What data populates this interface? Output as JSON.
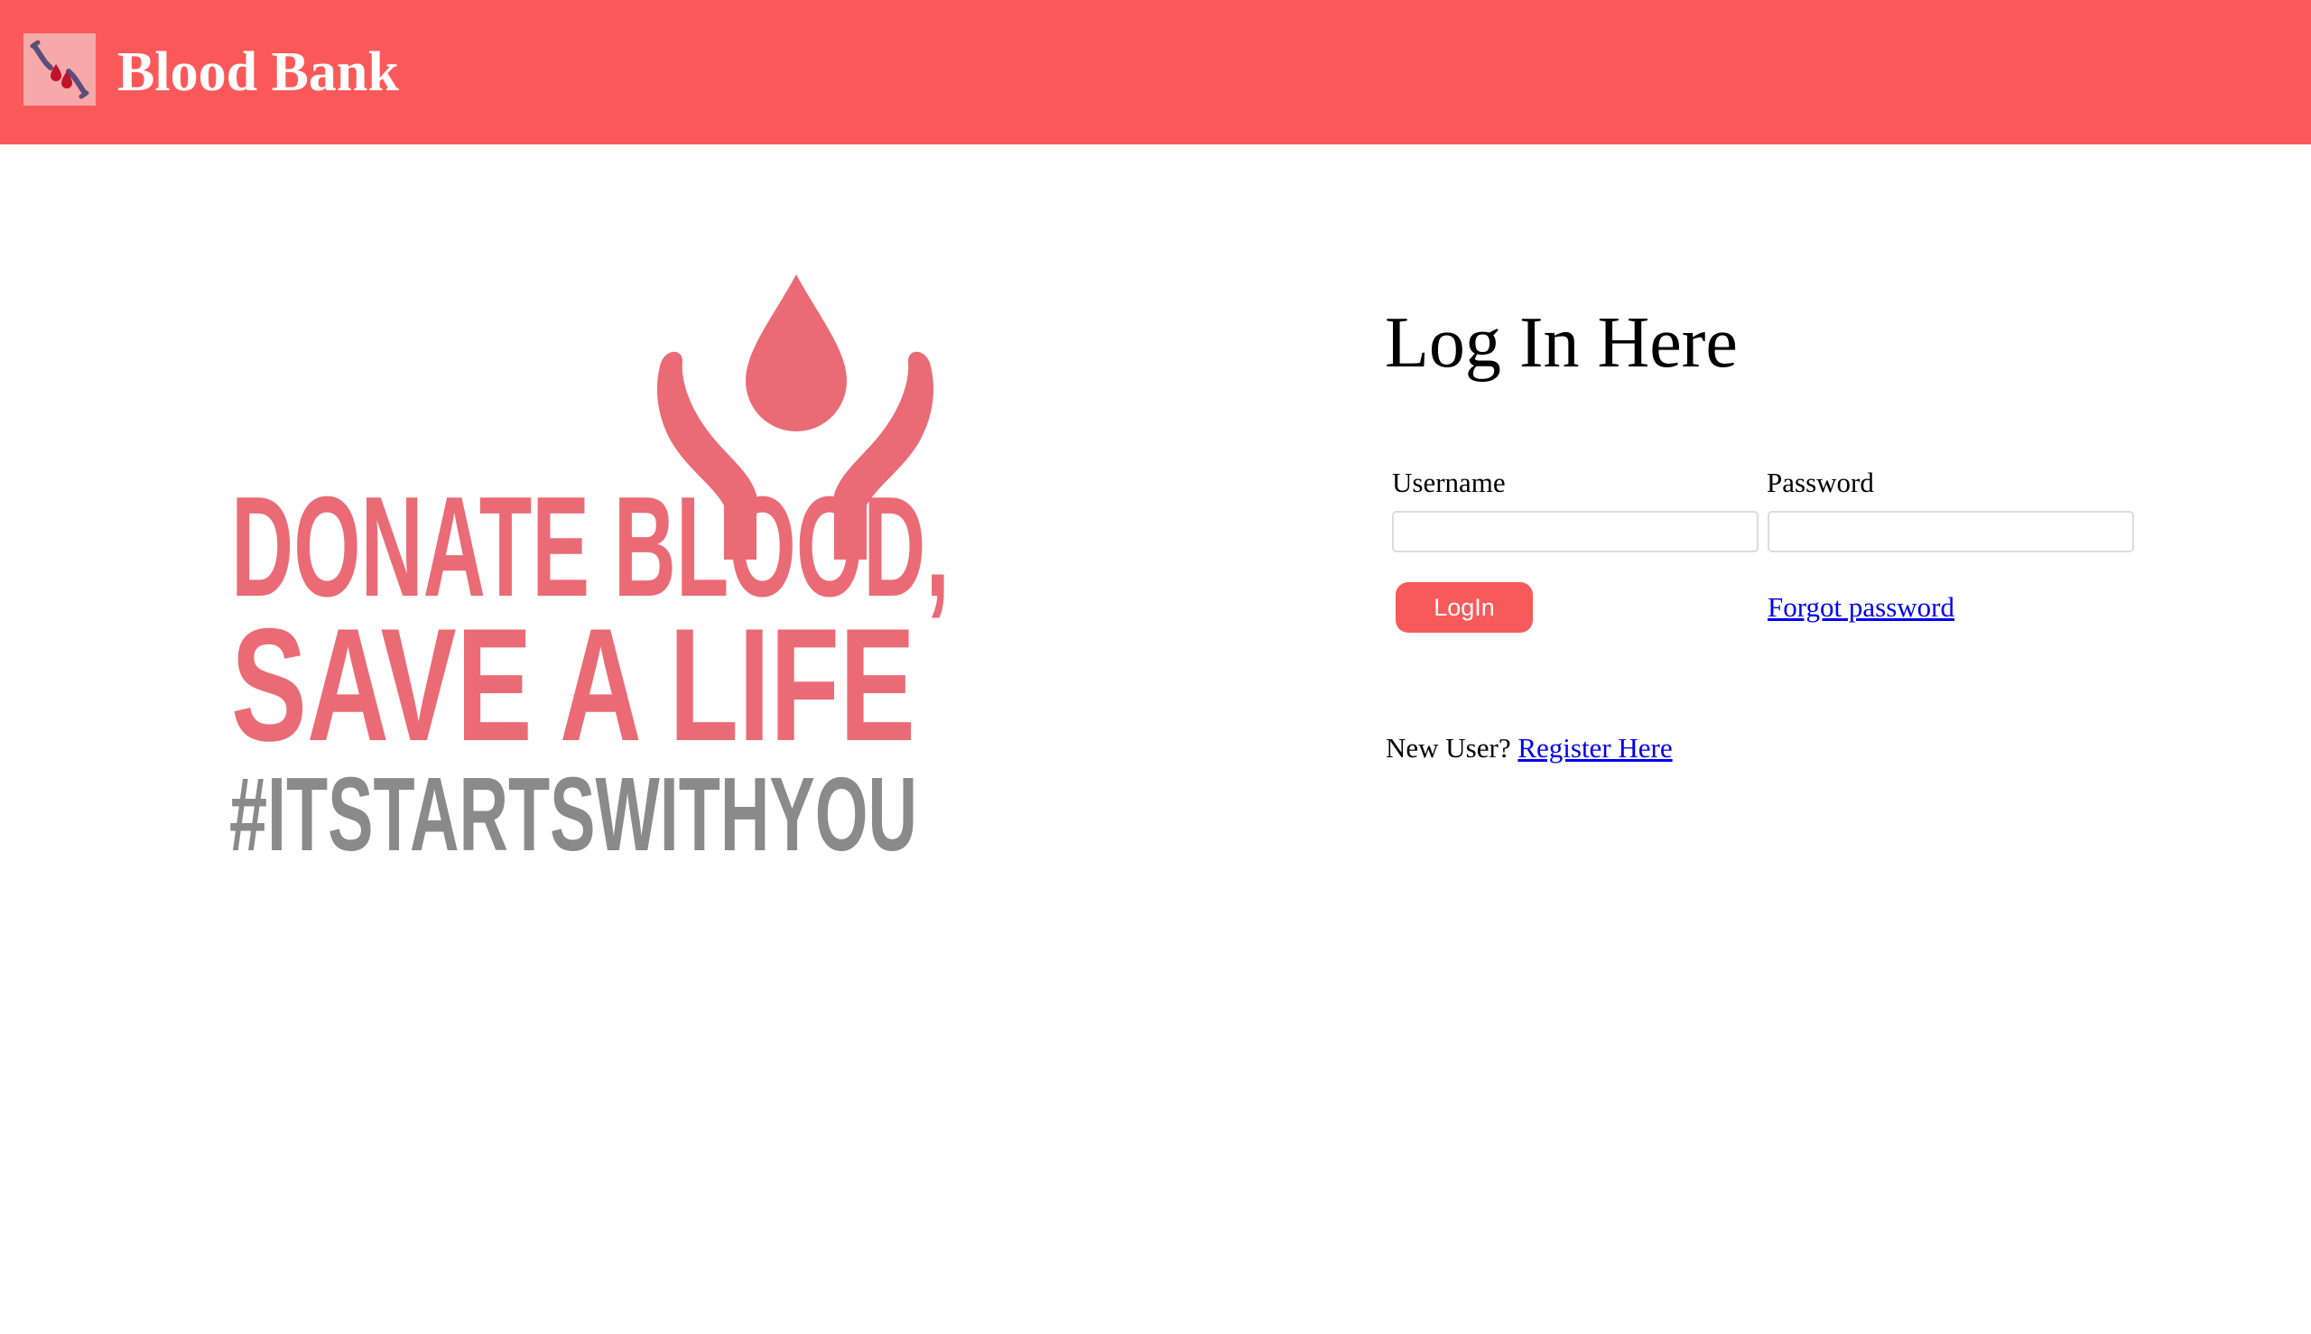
{
  "header": {
    "brand_title": "Blood Bank",
    "logo_icon": "hands-blood-drops-icon",
    "background_color": "#fb5959"
  },
  "poster": {
    "line1": "DONATE BLOOD,",
    "line2": "SAVE A LIFE",
    "line3": "#ITSTARTSWITHYOU",
    "icon": "hands-holding-blood-drop-icon",
    "accent_color": "#ea6b75",
    "tag_color": "#8a8a8a"
  },
  "login": {
    "title": "Log In Here",
    "username_label": "Username",
    "username_value": "",
    "password_label": "Password",
    "password_value": "",
    "login_button": "LogIn",
    "forgot_password": "Forgot password",
    "new_user_text": "New User?",
    "register_link": "Register Here",
    "button_color": "#f75a5a",
    "link_color": "#0000ee"
  }
}
